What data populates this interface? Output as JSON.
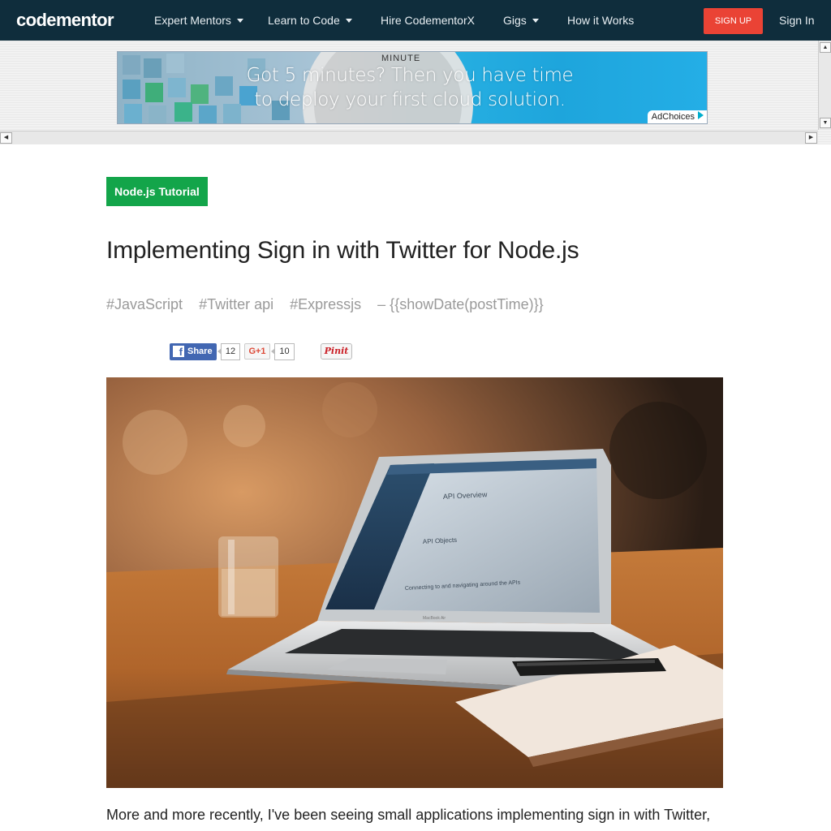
{
  "nav": {
    "logo": "codementor",
    "items": [
      {
        "label": "Expert Mentors",
        "dropdown": true
      },
      {
        "label": "Learn to Code",
        "dropdown": true
      },
      {
        "label": "Hire CodementorX",
        "dropdown": false
      },
      {
        "label": "Gigs",
        "dropdown": true
      },
      {
        "label": "How it Works",
        "dropdown": false
      }
    ],
    "signup": "SIGN UP",
    "signin": "Sign In"
  },
  "ad": {
    "line1": "Got 5 minutes? Then you have time",
    "line2": "to deploy your first cloud solution.",
    "dial_text": "MINUTE",
    "adchoices": "AdChoices",
    "colors": {
      "accent": "#1ea5dc"
    }
  },
  "article": {
    "category": "Node.js Tutorial",
    "title": "Implementing Sign in with Twitter for Node.js",
    "tags": [
      "#JavaScript",
      "#Twitter api",
      "#Expressjs",
      "– {{showDate(postTime)}}"
    ],
    "share": {
      "facebook_label": "Share",
      "facebook_count": "12",
      "gplus_label": "G+1",
      "gplus_count": "10",
      "pinterest_label": "Pinit"
    },
    "hero_image": {
      "screen_heading": "API Overview",
      "screen_sub1": "API Objects",
      "screen_sub2": "Connecting to and navigating around the APIs",
      "laptop_brand": "MacBook Air"
    },
    "lead": "More and more recently, I've been seeing small applications implementing sign in with Twitter,"
  },
  "colors": {
    "nav_bg": "#0f2d3c",
    "signup_bg": "#ea4335",
    "badge_bg": "#13a54a",
    "facebook": "#4267b2"
  }
}
